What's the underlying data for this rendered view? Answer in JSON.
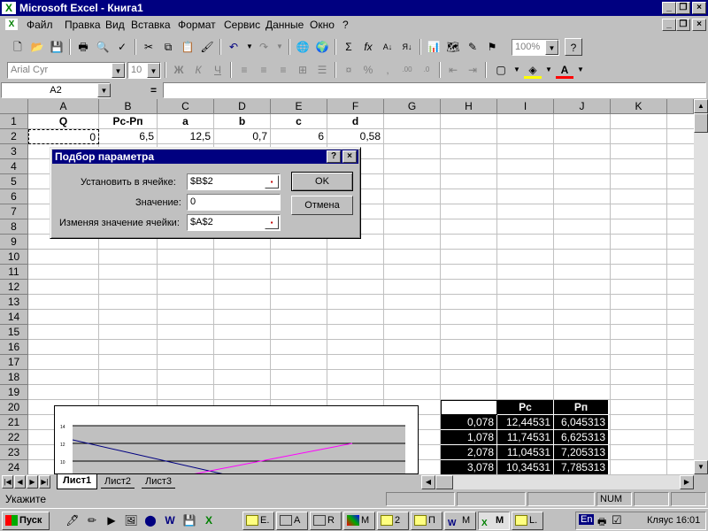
{
  "window": {
    "title": "Microsoft Excel - Книга1"
  },
  "menu": [
    "Файл",
    "Правка",
    "Вид",
    "Вставка",
    "Формат",
    "Сервис",
    "Данные",
    "Окно",
    "?"
  ],
  "toolbar": {
    "zoom": "100%",
    "font": "Arial Cyr",
    "size": "10",
    "bold": "Ж",
    "italic": "К",
    "underline": "Ч",
    "percent": "%",
    "comma": ","
  },
  "formula": {
    "namebox": "A2",
    "equals": "="
  },
  "columns": [
    "A",
    "B",
    "C",
    "D",
    "E",
    "F",
    "G",
    "H",
    "I",
    "J",
    "K"
  ],
  "rows": [
    "1",
    "2",
    "3",
    "4",
    "5",
    "6",
    "7",
    "8",
    "9",
    "10",
    "11",
    "12",
    "13",
    "14",
    "15",
    "16",
    "17",
    "18",
    "19",
    "20",
    "21",
    "22",
    "23",
    "24"
  ],
  "cells": {
    "A1": "Q",
    "B1": "Pc-Pп",
    "C1": "a",
    "D1": "b",
    "E1": "c",
    "F1": "d",
    "A2": "0",
    "B2": "6,5",
    "C2": "12,5",
    "D2": "0,7",
    "E2": "6",
    "F2": "0,58"
  },
  "table": {
    "headers": [
      "",
      "Pc",
      "Pп"
    ],
    "rows": [
      [
        "0,078",
        "12,44531",
        "6,045313"
      ],
      [
        "1,078",
        "11,74531",
        "6,625313"
      ],
      [
        "2,078",
        "11,04531",
        "7,205313"
      ],
      [
        "3,078",
        "10,34531",
        "7,785313"
      ]
    ]
  },
  "dialog": {
    "title": "Подбор параметра",
    "set_cell_label": "Установить в ячейке:",
    "set_cell_value": "$B$2",
    "value_label": "Значение:",
    "value_value": "0",
    "changing_label": "Изменяя значение ячейки:",
    "changing_value": "$A$2",
    "ok": "OK",
    "cancel": "Отмена",
    "help": "?",
    "close": "×"
  },
  "chart": {
    "y_ticks": [
      "14",
      "12",
      "10"
    ]
  },
  "sheets": [
    "Лист1",
    "Лист2",
    "Лист3"
  ],
  "status": {
    "mode": "Укажите",
    "num": "NUM"
  },
  "taskbar": {
    "start": "Пуск",
    "tasks": [
      "E.",
      "A",
      "R",
      "M",
      "2",
      "П",
      "M",
      "M",
      "L."
    ],
    "lang": "En",
    "tray_text": "Кляус 16:01"
  },
  "colors": {
    "titlebar": "#000080",
    "face": "#c0c0c0",
    "series1": "#000080",
    "series2": "#ff00ff"
  }
}
